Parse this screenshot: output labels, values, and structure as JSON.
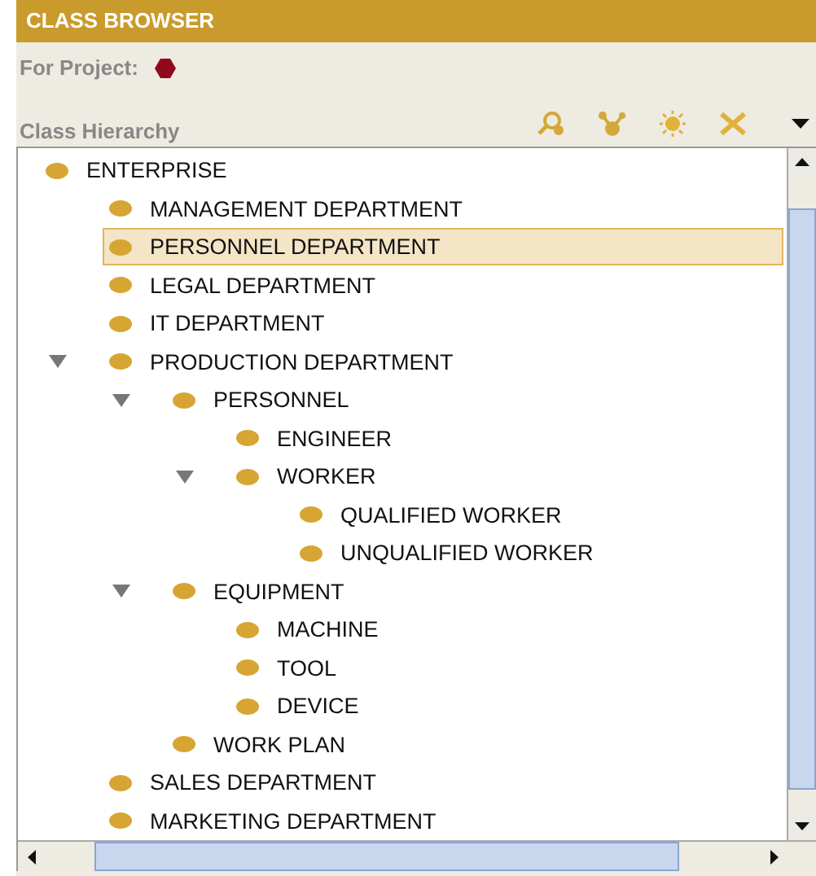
{
  "panel": {
    "title": "CLASS BROWSER"
  },
  "project": {
    "label": "For Project:"
  },
  "hierarchy": {
    "label": "Class Hierarchy",
    "root": {
      "label": "ENTERPRISE",
      "selected": false,
      "children": [
        {
          "label": "MANAGEMENT DEPARTMENT",
          "selected": false
        },
        {
          "label": "PERSONNEL DEPARTMENT",
          "selected": true
        },
        {
          "label": "LEGAL DEPARTMENT",
          "selected": false
        },
        {
          "label": "IT DEPARTMENT",
          "selected": false
        },
        {
          "label": "PRODUCTION DEPARTMENT",
          "selected": false,
          "expanded": true,
          "children": [
            {
              "label": "PERSONNEL",
              "selected": false,
              "expanded": true,
              "children": [
                {
                  "label": "ENGINEER",
                  "selected": false
                },
                {
                  "label": "WORKER",
                  "selected": false,
                  "expanded": true,
                  "children": [
                    {
                      "label": "QUALIFIED WORKER",
                      "selected": false
                    },
                    {
                      "label": "UNQUALIFIED WORKER",
                      "selected": false
                    }
                  ]
                }
              ]
            },
            {
              "label": "EQUIPMENT",
              "selected": false,
              "expanded": true,
              "children": [
                {
                  "label": "MACHINE",
                  "selected": false
                },
                {
                  "label": "TOOL",
                  "selected": false
                },
                {
                  "label": "DEVICE",
                  "selected": false
                }
              ]
            },
            {
              "label": "WORK PLAN",
              "selected": false
            }
          ]
        },
        {
          "label": "SALES DEPARTMENT",
          "selected": false
        },
        {
          "label": "MARKETING DEPARTMENT",
          "selected": false
        }
      ]
    }
  }
}
